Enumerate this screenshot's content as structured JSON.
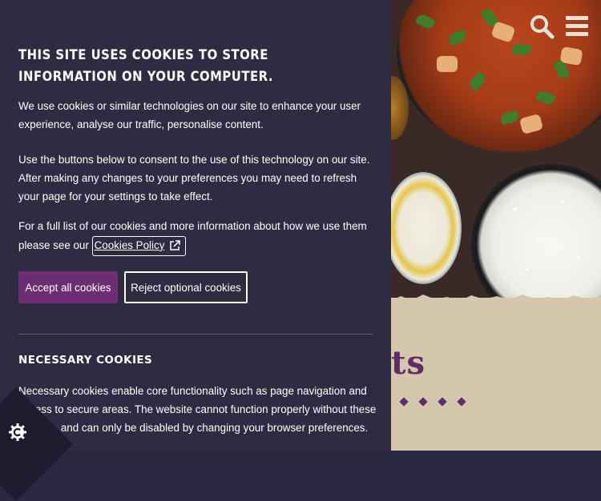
{
  "header": {
    "search_icon": "search-icon",
    "menu_icon": "menu-icon"
  },
  "background": {
    "decorative_letters": "ts"
  },
  "cookie_banner": {
    "title": "This site uses cookies to store information on your computer.",
    "paragraph_1": "We use cookies or similar technologies on our site to enhance your user experience, analyse our traffic, personalise content.",
    "paragraph_2": "Use the buttons below to consent to the use of this technology on our site. After making any changes to your preferences you may need to refresh your page for your settings to take effect.",
    "paragraph_3_prefix": "For a full list of our cookies and more information about how we use them please see our",
    "policy_link_label": "Cookies Policy",
    "accept_label": "Accept all cookies",
    "reject_label": "Reject optional cookies",
    "necessary_heading": "Necessary cookies",
    "necessary_text": "Necessary cookies enable core functionality such as page navigation and access to secure areas. The website cannot function properly without these cookies, and can only be disabled by changing your browser preferences."
  },
  "colors": {
    "panel_bg": "#2e2c42",
    "accept_bg": "#6c2d73",
    "accent_purple": "#5c2e63"
  }
}
